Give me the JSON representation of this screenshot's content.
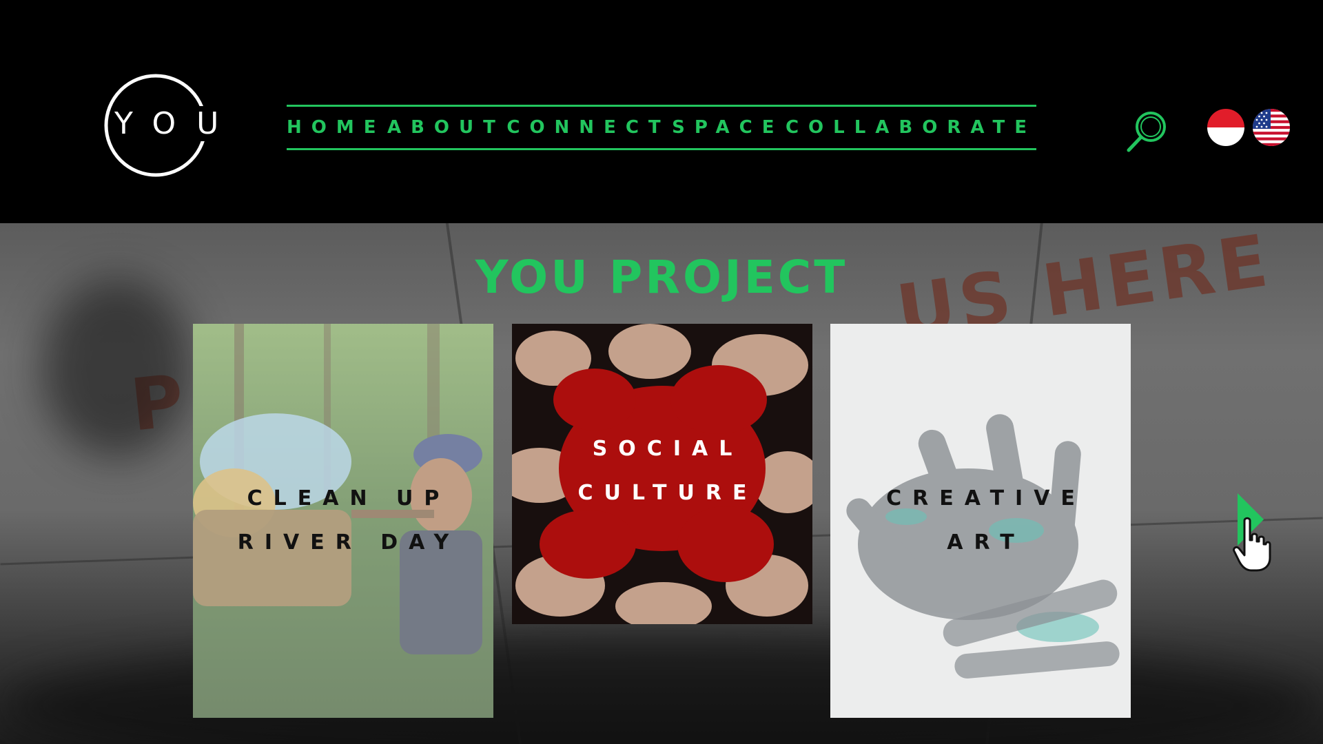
{
  "brand": {
    "logo_text": "YOU"
  },
  "nav": {
    "items": [
      {
        "label": "HOME"
      },
      {
        "label": "ABOUT"
      },
      {
        "label": "CONNECT"
      },
      {
        "label": "SPACE"
      },
      {
        "label": "COLLABORATE"
      }
    ]
  },
  "header_icons": {
    "search": "search-icon",
    "languages": [
      {
        "icon": "indonesia-flag-icon"
      },
      {
        "icon": "usa-flag-icon"
      }
    ]
  },
  "hero": {
    "title": "YOU PROJECT",
    "cards": [
      {
        "line1": "CLEAN UP",
        "line2": "RIVER DAY"
      },
      {
        "line1": "SOCIAL",
        "line2": "CULTURE"
      },
      {
        "line1": "CREATIVE",
        "line2": "ART"
      }
    ],
    "next_icon": "play-arrow-icon"
  },
  "colors": {
    "accent": "#22c55e",
    "background": "#000000",
    "logo": "#ffffff"
  }
}
